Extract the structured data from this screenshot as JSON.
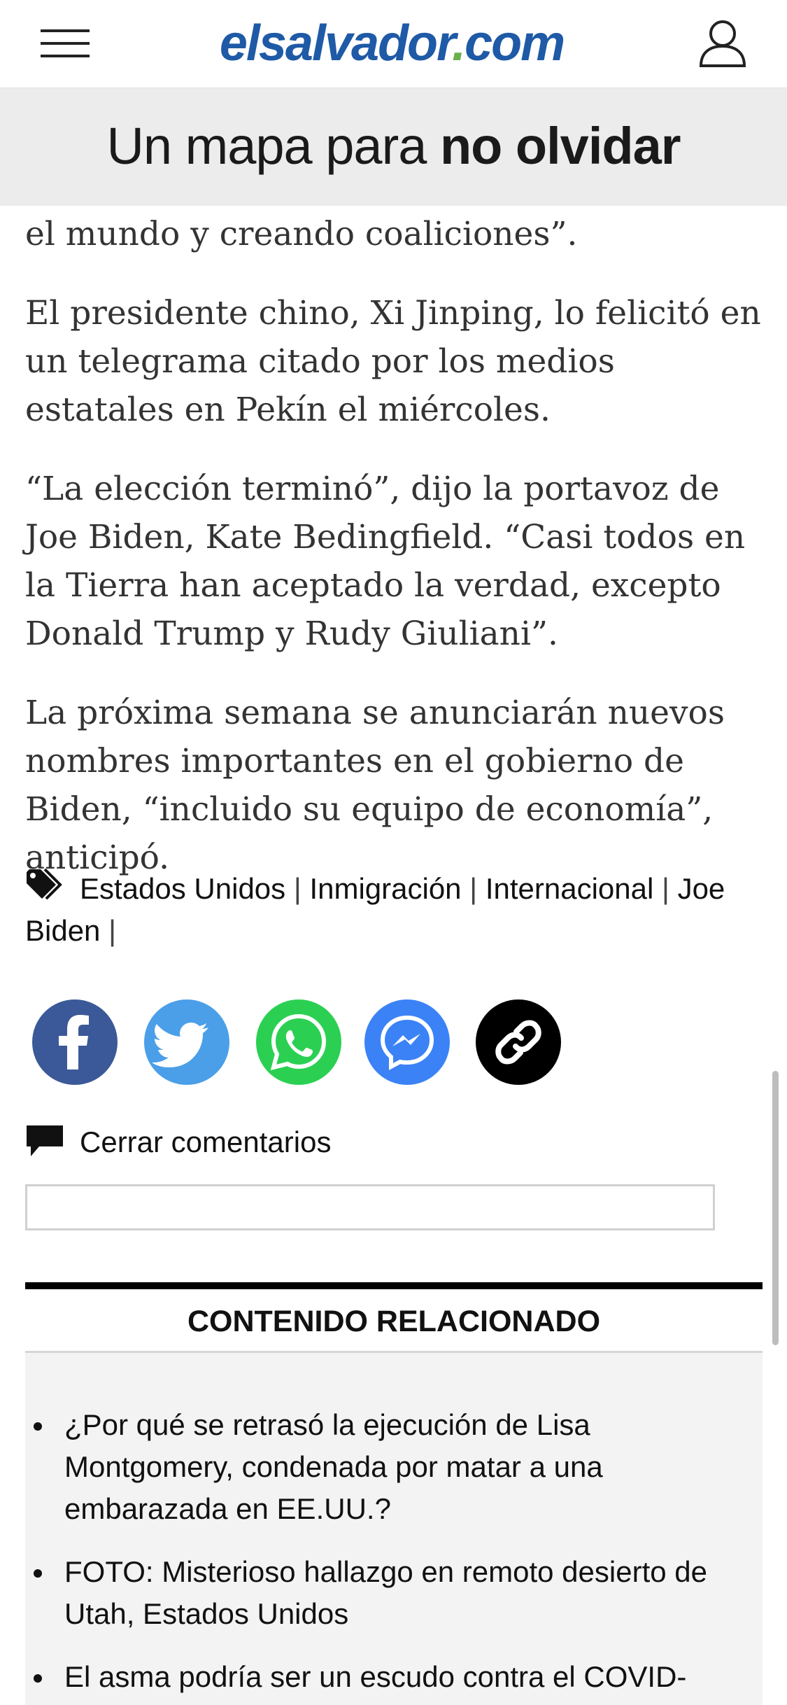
{
  "header": {
    "menu_icon": "hamburger-menu-icon",
    "logo_main": "elsalvador",
    "logo_dot": ".",
    "logo_tld": "com",
    "user_icon": "user-profile-icon",
    "brand_color": "#1e5aa6",
    "accent_color": "#6ab04c"
  },
  "banner": {
    "text_regular": "Un mapa para ",
    "text_bold": "no olvidar"
  },
  "article": {
    "paragraphs": [
      "el mundo y creando coaliciones”.",
      "El presidente chino, Xi Jinping, lo felicitó en un telegrama citado por los medios estatales en Pekín el miércoles.",
      "“La elección terminó”, dijo la portavoz de Joe Biden, Kate Bedingfield. “Casi todos en la Tierra han aceptado la verdad, excepto Donald Trump y Rudy Giuliani”.",
      "La próxima semana se anunciarán nuevos nombres importantes en el gobierno de Biden, “incluido su equipo de economía”, anticipó."
    ]
  },
  "tags": {
    "icon": "tag-icon",
    "items": [
      "Estados Unidos",
      "Inmigración",
      "Internacional",
      "Joe Biden"
    ],
    "separator": "|"
  },
  "share": {
    "buttons": [
      {
        "name": "facebook",
        "icon": "facebook-icon",
        "color": "#3b5998"
      },
      {
        "name": "twitter",
        "icon": "twitter-icon",
        "color": "#4a9fe8"
      },
      {
        "name": "whatsapp",
        "icon": "whatsapp-icon",
        "color": "#2bd052"
      },
      {
        "name": "messenger",
        "icon": "messenger-icon",
        "color": "#3b82f6"
      },
      {
        "name": "copy-link",
        "icon": "link-icon",
        "color": "#000000"
      }
    ]
  },
  "comments": {
    "icon": "comment-icon",
    "toggle_label": "Cerrar comentarios"
  },
  "related": {
    "title": "CONTENIDO RELACIONADO",
    "items": [
      "¿Por qué se retrasó la ejecución de Lisa Montgomery, condenada por matar a una embarazada en EE.UU.?",
      "FOTO: Misterioso hallazgo en remoto desierto de Utah, Estados Unidos",
      "El asma podría ser un escudo contra el COVID-"
    ]
  }
}
